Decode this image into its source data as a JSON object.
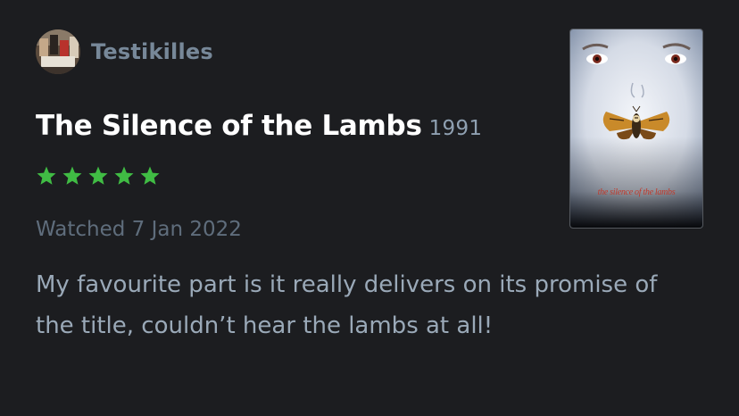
{
  "review": {
    "author": "Testikilles",
    "film_title": "The Silence of the Lambs",
    "film_year": "1991",
    "rating": 5,
    "rating_max": 5,
    "watched_text": "Watched 7 Jan 2022",
    "body": "My favourite part is it really delivers on its promise of the title, couldn’t hear the lambs at all!"
  },
  "poster": {
    "caption": "the silence of the lambs"
  },
  "colors": {
    "background": "#1c1d20",
    "star": "#40bc44",
    "author": "#778899",
    "title": "#ffffff",
    "muted": "#5f6d7c",
    "body": "#9aa9b8"
  }
}
